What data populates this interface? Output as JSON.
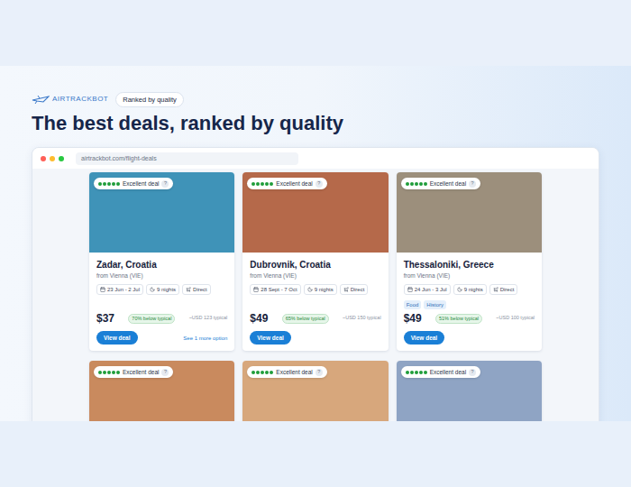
{
  "logo": {
    "text": "AIRTRACKBOT"
  },
  "pill": "Ranked by quality",
  "heading": "The best deals, ranked by quality",
  "browser": {
    "url": "airtrackbot.com/flight-deals"
  },
  "cards": [
    {
      "title": "Zadar, Croatia",
      "from": "from Vienna (VIE)",
      "dates": "23 Jun - 2 Jul",
      "nights": "9 nights",
      "stops": "Direct",
      "tags": [],
      "price": "$37",
      "badge": "70% below typical",
      "typical": "~USD 123 typical",
      "button": "View deal",
      "more": "See 1 more option",
      "color": "#3f93b8",
      "rating": {
        "stars": 5,
        "label": "Excellent deal",
        "help": "?"
      }
    },
    {
      "title": "Dubrovnik, Croatia",
      "from": "from Vienna (VIE)",
      "dates": "28 Sept - 7 Oct",
      "nights": "9 nights",
      "stops": "Direct",
      "tags": [],
      "price": "$49",
      "badge": "65% below typical",
      "typical": "~USD 150 typical",
      "button": "View deal",
      "more": "",
      "color": "#b5694a",
      "rating": {
        "stars": 5,
        "label": "Excellent deal",
        "help": "?"
      }
    },
    {
      "title": "Thessaloniki, Greece",
      "from": "from Vienna (VIE)",
      "dates": "24 Jun - 3 Jul",
      "nights": "9 nights",
      "stops": "Direct",
      "tags": [
        "Food",
        "History"
      ],
      "price": "$49",
      "badge": "51% below typical",
      "typical": "~USD 100 typical",
      "button": "View deal",
      "more": "",
      "color": "#9c8f7c",
      "rating": {
        "stars": 5,
        "label": "Excellent deal",
        "help": "?"
      }
    }
  ],
  "more_cards": [
    {
      "color": "#c98a5e",
      "rating": {
        "stars": 5,
        "label": "Excellent deal",
        "help": "?"
      }
    },
    {
      "color": "#d7a77c",
      "rating": {
        "stars": 5,
        "label": "Excellent deal",
        "help": "?"
      }
    },
    {
      "color": "#8fa4c4",
      "rating": {
        "stars": 5,
        "label": "Excellent deal",
        "help": "?"
      }
    }
  ]
}
